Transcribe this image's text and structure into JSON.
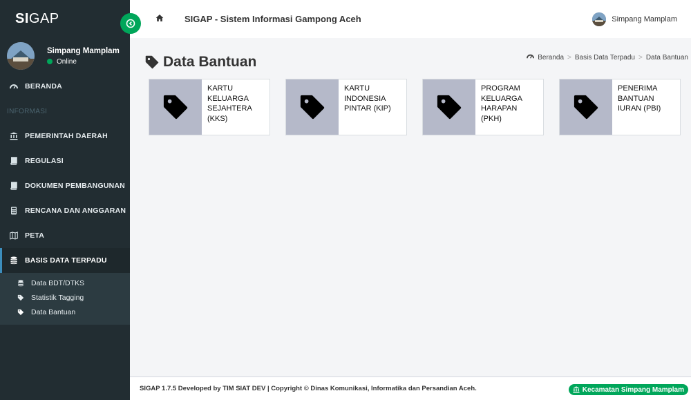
{
  "brand": {
    "bold": "SI",
    "light": "GAP"
  },
  "sidebar": {
    "user": {
      "name": "Simpang Mamplam",
      "status": "Online"
    },
    "items": [
      {
        "label": "BERANDA",
        "icon": "dashboard-icon"
      },
      {
        "label": "INFORMASI",
        "header": true
      },
      {
        "label": "PEMERINTAH DAERAH",
        "icon": "bank-icon"
      },
      {
        "label": "REGULASI",
        "icon": "book-icon"
      },
      {
        "label": "DOKUMEN PEMBANGUNAN",
        "icon": "book-icon"
      },
      {
        "label": "RENCANA DAN ANGGARAN",
        "icon": "calculator-icon"
      },
      {
        "label": "PETA",
        "icon": "map-icon"
      },
      {
        "label": "BASIS DATA TERPADU",
        "icon": "database-icon"
      }
    ],
    "submenu": [
      {
        "label": "Data BDT/DTKS",
        "icon": "database-icon"
      },
      {
        "label": "Statistik Tagging",
        "icon": "tag-icon"
      },
      {
        "label": "Data Bantuan",
        "icon": "tag-icon"
      }
    ]
  },
  "header": {
    "title": "SIGAP - Sistem Informasi Gampong Aceh",
    "user_name": "Simpang Mamplam"
  },
  "page": {
    "title": "Data Bantuan",
    "breadcrumb": [
      "Beranda",
      "Basis Data Terpadu",
      "Data Bantuan"
    ]
  },
  "cards": [
    {
      "lines": [
        "KARTU",
        "KELUARGA",
        "SEJAHTERA",
        "(KKS)"
      ]
    },
    {
      "lines": [
        "KARTU",
        "INDONESIA",
        "PINTAR (KIP)"
      ]
    },
    {
      "lines": [
        "PROGRAM",
        "KELUARGA",
        "HARAPAN",
        "(PKH)"
      ]
    },
    {
      "lines": [
        "PENERIMA",
        "BANTUAN",
        "IURAN (PBI)"
      ]
    }
  ],
  "footer": {
    "text": "SIGAP 1.7.5 Developed by TIM SIAT DEV | Copyright © Dinas Komunikasi, Informatika dan Persandian Aceh.",
    "badge": "Kecamatan Simpang Mamplam"
  },
  "colors": {
    "accent_green": "#00a65a",
    "sidebar_bg": "#222d32",
    "card_icon_bg": "#b5b9c9"
  }
}
